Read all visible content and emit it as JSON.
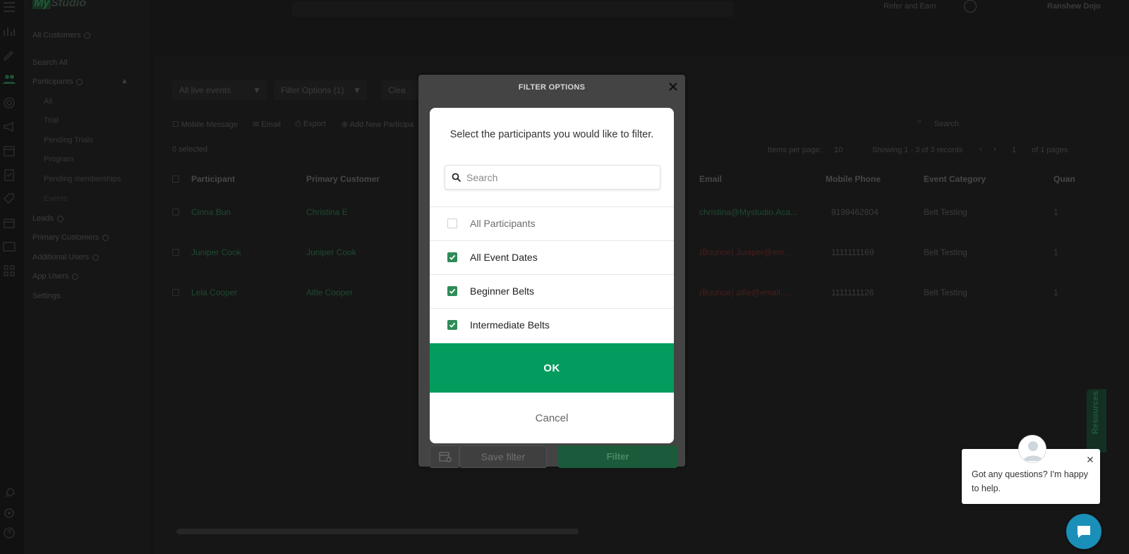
{
  "app": {
    "logo_my": "My",
    "logo_rest": "Studio",
    "refer": "Refer and Earn",
    "account": "Ranshew Dojo"
  },
  "sidebar": {
    "all_customers": "All Customers",
    "search_all": "Search All",
    "participants": "Participants",
    "sub_items": [
      "All",
      "Trial",
      "Pending Trials",
      "Program",
      "Pending memberships",
      "Events"
    ],
    "leads": "Leads",
    "primary_customers": "Primary Customers",
    "additional_users": "Additional Users",
    "app_users": "App Users",
    "settings": "Settings"
  },
  "toolbar": {
    "event_select": "All live events",
    "filter_options": "Filter Options (1)",
    "clear": "Clea",
    "mobile_message": "Mobile Message",
    "email": "Email",
    "export": "Export",
    "add_new": "Add New Participa",
    "search_placeholder": "Search",
    "selected": "0 selected",
    "items_per_page": "Items per page:",
    "per_page_value": "10",
    "showing": "Showing 1 - 3 of 3 records",
    "page_value": "1",
    "of_pages": "of 1 pages"
  },
  "table": {
    "columns": [
      "Participant",
      "Primary Customer",
      "Email",
      "Mobile Phone",
      "Event Category",
      "Quan"
    ],
    "rows": [
      {
        "participant": "Cinna Bun",
        "customer": "Christina E",
        "email": "christina@Mystudio.Aca...",
        "phone": "9199462804",
        "category": "Belt Testing",
        "qty": "1"
      },
      {
        "participant": "Juniper Cook",
        "customer": "Juniper Cook",
        "email": "(Bounce) Juniper@em...",
        "phone": "1111111169",
        "category": "Belt Testing",
        "qty": "1"
      },
      {
        "participant": "Lela Cooper",
        "customer": "Alfie Cooper",
        "email": "(Bounce) alfie@email....",
        "phone": "1111111126",
        "category": "Belt Testing",
        "qty": "1"
      }
    ]
  },
  "filter_panel": {
    "title": "FILTER OPTIONS",
    "save_filter": "Save filter",
    "filter": "Filter"
  },
  "modal": {
    "prompt": "Select the participants you would like to filter.",
    "search_placeholder": "Search",
    "options": [
      {
        "label": "All Participants",
        "checked": false
      },
      {
        "label": "All Event Dates",
        "checked": true
      },
      {
        "label": "Beginner Belts",
        "checked": true
      },
      {
        "label": "Intermediate Belts",
        "checked": true
      }
    ],
    "ok": "OK",
    "cancel": "Cancel"
  },
  "chat": {
    "message": "Got any questions? I'm happy to help."
  },
  "resources_tab": "Resources",
  "colors": {
    "ok_green": "#039c5e",
    "checkbox_green": "#2e8b57",
    "chat_blue": "#1a8fb8"
  }
}
